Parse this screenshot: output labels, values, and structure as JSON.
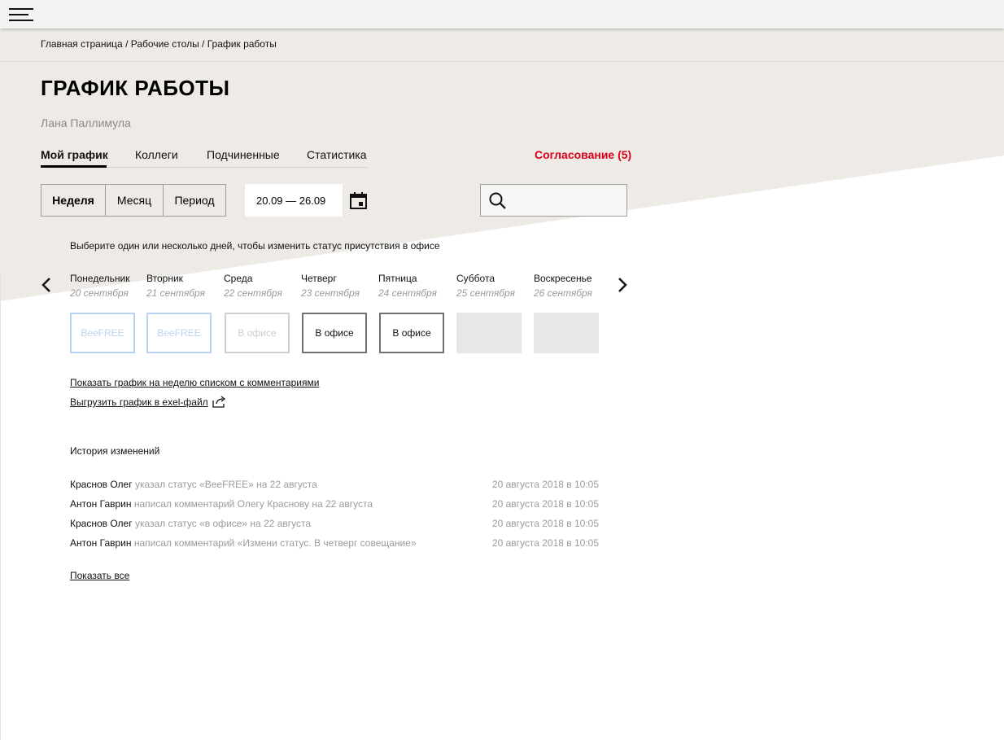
{
  "colors": {
    "accent": "#d8001a",
    "background": "#eeebe7",
    "beefree_border": "#b8d2f0"
  },
  "topbar": {
    "menu_icon": "hamburger-menu-icon"
  },
  "breadcrumbs": [
    "Главная страница",
    "Рабочие столы",
    "График работы"
  ],
  "breadcrumb_separator": "/",
  "page": {
    "title": "ГРАФИК РАБОТЫ",
    "user": "Лана Паллимула"
  },
  "tabs": [
    "Мой график",
    "Коллеги",
    "Подчиненные",
    "Статистика"
  ],
  "approval_label": "Согласование (5)",
  "period": {
    "options": [
      "Неделя",
      "Месяц",
      "Период"
    ],
    "selected": "Неделя"
  },
  "date_range": "20.09 — 26.09",
  "search": {
    "placeholder": "",
    "icon": "search-icon"
  },
  "hint": "Выберите один или несколько дней, чтобы изменить статус присутствия в офисе",
  "days": [
    {
      "name": "Понедельник",
      "date": "20 сентября",
      "status": "BeeFREE"
    },
    {
      "name": "Вторник",
      "date": "21 сентября",
      "status": "BeeFREE"
    },
    {
      "name": "Среда",
      "date": "22 сентября",
      "status": "В офисе"
    },
    {
      "name": "Четверг",
      "date": "23 сентября",
      "status": "В офисе"
    },
    {
      "name": "Пятница",
      "date": "24 сентября",
      "status": "В офисе"
    },
    {
      "name": "Суббота",
      "date": "25 сентября",
      "status": ""
    },
    {
      "name": "Воскресенье",
      "date": "26 сентября",
      "status": ""
    }
  ],
  "links": {
    "week_list": "Показать график на неделю списком с комментариями",
    "export": "Выгрузить график в exel-файл"
  },
  "history": {
    "title": "История изменений",
    "rows": [
      {
        "author": "Краснов Олег",
        "action": "указал статус «BeeFREE» на 22 августа",
        "time": "20 августа 2018 в 10:05"
      },
      {
        "author": "Антон Гаврин",
        "action": "написал комментарий Олегу Краснову на 22 августа",
        "time": "20 августа 2018 в 10:05"
      },
      {
        "author": "Краснов Олег",
        "action": "указал статус «в офисе» на 22 августа",
        "time": "20 августа 2018 в 10:05"
      },
      {
        "author": "Антон Гаврин",
        "action": "написал комментарий «Измени статус. В четверг совещание»",
        "time": "20 августа 2018 в 10:05"
      }
    ],
    "show_all": "Показать все"
  }
}
